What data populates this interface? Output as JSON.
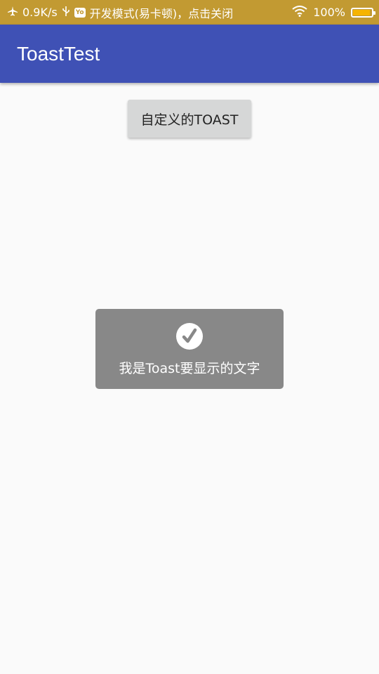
{
  "status_bar": {
    "network_speed": "0.9K/s",
    "notice": "开发模式(易卡顿)，点击关闭",
    "battery_percent": "100%",
    "battery_level": 1.0
  },
  "app_bar": {
    "title": "ToastTest"
  },
  "main": {
    "button_label": "自定义的TOAST"
  },
  "toast": {
    "icon": "check-circle-icon",
    "message": "我是Toast要显示的文字"
  },
  "colors": {
    "status_bar": "#c29a32",
    "app_bar": "#3f51b5",
    "toast_bg": "#888888",
    "button_bg": "#d6d7d7"
  }
}
